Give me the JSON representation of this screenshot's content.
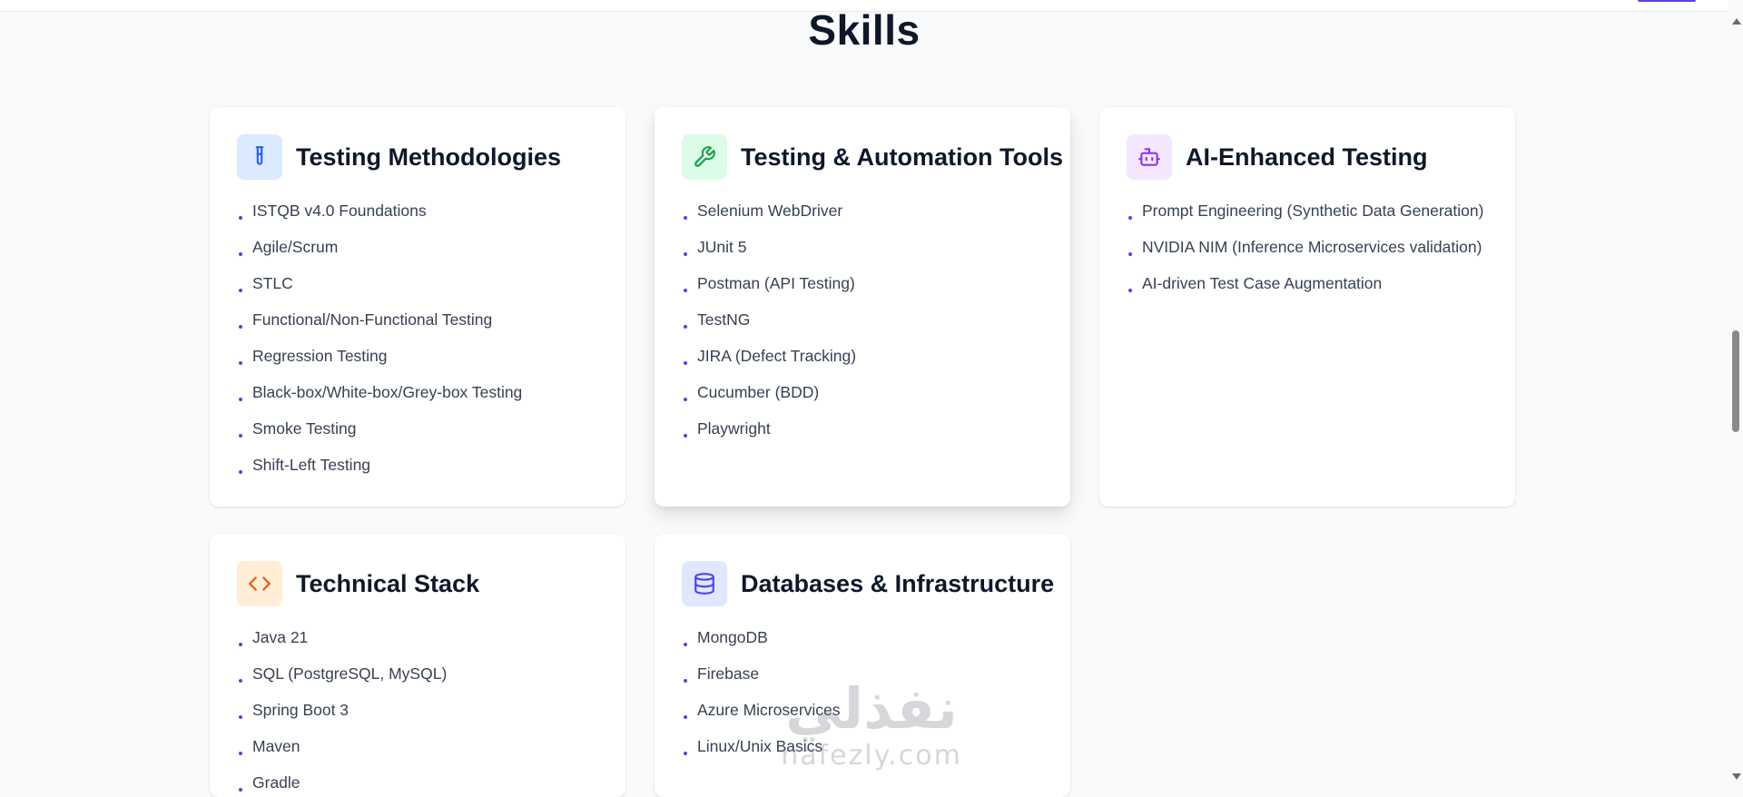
{
  "section": {
    "title": "Skills"
  },
  "cards": [
    {
      "title": "Testing Methodologies",
      "icon": "test-tube-icon",
      "accent": "#2563eb",
      "icon_bg": "#dbeafe",
      "items": [
        "ISTQB v4.0 Foundations",
        "Agile/Scrum",
        "STLC",
        "Functional/Non-Functional Testing",
        "Regression Testing",
        "Black-box/White-box/Grey-box Testing",
        "Smoke Testing",
        "Shift-Left Testing"
      ]
    },
    {
      "title": "Testing & Automation Tools",
      "icon": "wrench-icon",
      "accent": "#16a34a",
      "icon_bg": "#dcfce7",
      "items": [
        "Selenium WebDriver",
        "JUnit 5",
        "Postman (API Testing)",
        "TestNG",
        "JIRA (Defect Tracking)",
        "Cucumber (BDD)",
        "Playwright"
      ]
    },
    {
      "title": "AI-Enhanced Testing",
      "icon": "robot-icon",
      "accent": "#9333ea",
      "icon_bg": "#f3e8ff",
      "items": [
        "Prompt Engineering (Synthetic Data Generation)",
        "NVIDIA NIM (Inference Microservices validation)",
        "AI-driven Test Case Augmentation"
      ]
    },
    {
      "title": "Technical Stack",
      "icon": "code-brackets-icon",
      "accent": "#ea580c",
      "icon_bg": "#ffedd5",
      "items": [
        "Java 21",
        "SQL (PostgreSQL, MySQL)",
        "Spring Boot 3",
        "Maven",
        "Gradle"
      ]
    },
    {
      "title": "Databases & Infrastructure",
      "icon": "database-icon",
      "accent": "#4f46e5",
      "icon_bg": "#e0e7ff",
      "items": [
        "MongoDB",
        "Firebase",
        "Azure Microservices",
        "Linux/Unix Basics"
      ]
    }
  ],
  "watermark": {
    "arabic": "نفذلي",
    "latin": "nafezly.com"
  },
  "colors": {
    "bullet": "#4f46e5",
    "page_bg": "#f9fafb",
    "card_bg": "#ffffff"
  }
}
